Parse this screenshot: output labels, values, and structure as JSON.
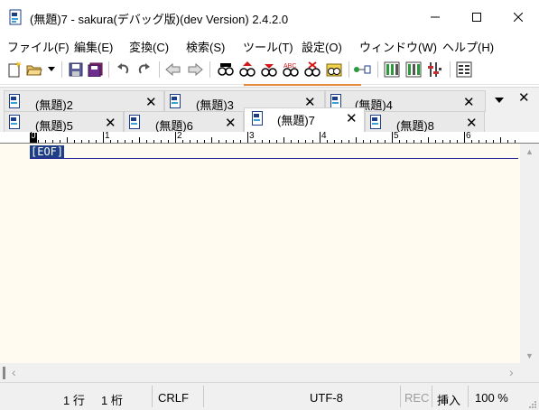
{
  "window": {
    "title": "(無題)7 - sakura(デバッグ版)(dev Version) 2.4.2.0"
  },
  "menu": [
    "ファイル(F)",
    "編集(E)",
    "変換(C)",
    "検索(S)",
    "ツール(T)",
    "設定(O)",
    "ウィンドウ(W)",
    "ヘルプ(H)"
  ],
  "tabs": {
    "row1": [
      "(無題)2",
      "(無題)3",
      "(無題)4"
    ],
    "row2": [
      "(無題)5",
      "(無題)6",
      "(無題)7",
      "(無題)8"
    ],
    "active": "(無題)7",
    "close_glyph": "✕"
  },
  "ruler": {
    "marks": [
      "0",
      "1",
      "2",
      "3",
      "4",
      "5",
      "6"
    ]
  },
  "editor": {
    "eof_marker": "[EOF]",
    "background": "#fffbf0"
  },
  "status": {
    "line": "1 行",
    "column": "1 桁",
    "line_ending": "CRLF",
    "encoding": "UTF-8",
    "rec": "REC",
    "insert_mode": "挿入",
    "zoom": "100 %"
  },
  "icons": {
    "title": "sakura-document-icon",
    "toolbar": [
      "new-icon",
      "open-icon",
      "dropdown-icon",
      "save-icon",
      "save-all-icon",
      "undo-icon",
      "redo-icon",
      "jump-back-icon",
      "jump-forward-icon",
      "search-icon",
      "search-prev-icon",
      "search-next-icon",
      "replace-icon",
      "clear-mark-icon",
      "bookmark-icon",
      "grep-icon",
      "compare-icon",
      "diff-icon",
      "outline-icon",
      "settings-icon"
    ]
  }
}
